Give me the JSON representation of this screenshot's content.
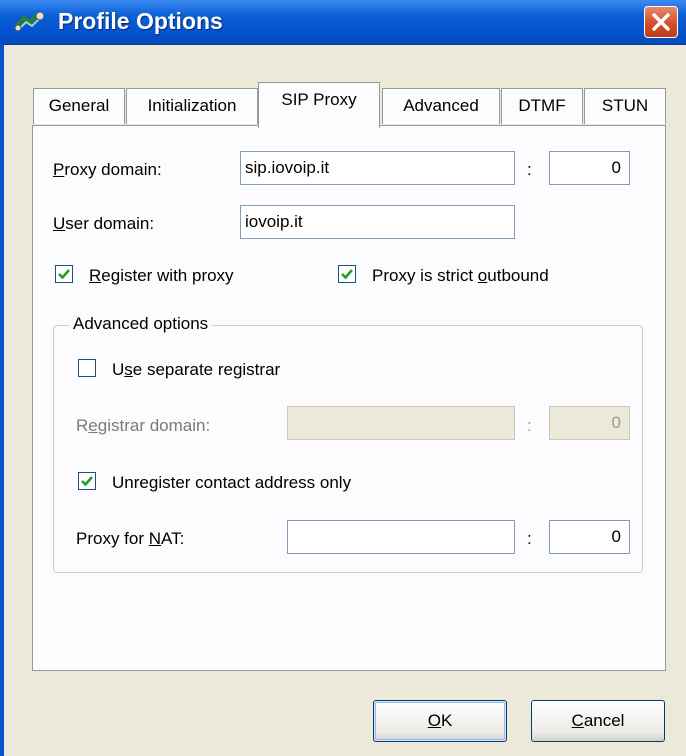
{
  "window": {
    "title": "Profile Options",
    "app_icon": "network-cable-icon",
    "close_icon": "close-x-icon"
  },
  "tabs": [
    {
      "label": "General",
      "active": false
    },
    {
      "label": "Initialization",
      "active": false
    },
    {
      "label": "SIP Proxy",
      "active": true
    },
    {
      "label": "Advanced",
      "active": false
    },
    {
      "label": "DTMF",
      "active": false
    },
    {
      "label": "STUN",
      "active": false
    }
  ],
  "sip_proxy": {
    "proxy_domain": {
      "label_mnemonic": "P",
      "label_rest": "roxy domain:",
      "value": "sip.iovoip.it",
      "port": "0"
    },
    "user_domain": {
      "label_mnemonic": "U",
      "label_rest": "ser domain:",
      "value": "iovoip.it"
    },
    "register_with_proxy": {
      "label_mnemonic": "R",
      "label_rest": "egister with proxy",
      "checked": true
    },
    "proxy_strict_outbound": {
      "label_pre": "Proxy is strict ",
      "label_mnemonic": "o",
      "label_rest": "utbound",
      "checked": true
    },
    "advanced_options": {
      "title": "Advanced options",
      "use_separate_registrar": {
        "label_pre": "U",
        "label_mnemonic": "s",
        "label_rest": "e separate registrar",
        "checked": false
      },
      "registrar_domain": {
        "label_pre": "R",
        "label_mnemonic": "e",
        "label_rest": "gistrar domain:",
        "value": "",
        "port": "0"
      },
      "unregister_contact_only": {
        "label_pre": "Unre",
        "label_mnemonic": "g",
        "label_rest": "ister contact address only",
        "checked": true
      },
      "proxy_for_nat": {
        "label_pre": "Proxy for ",
        "label_mnemonic": "N",
        "label_rest": "AT:",
        "value": "",
        "port": "0"
      }
    },
    "colon": ":"
  },
  "buttons": {
    "ok": {
      "mnemonic": "O",
      "rest": "K"
    },
    "cancel": {
      "mnemonic": "C",
      "rest": "ancel"
    }
  }
}
